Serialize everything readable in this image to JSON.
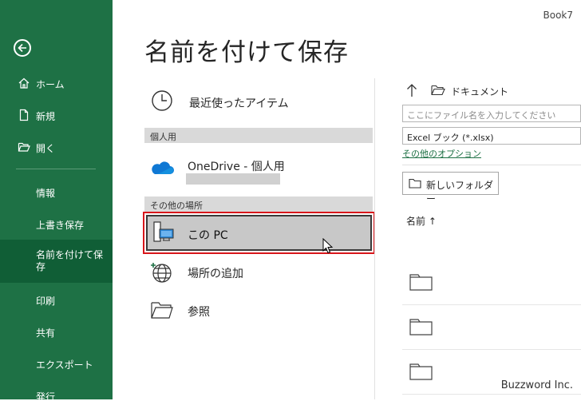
{
  "window": {
    "doc_name": "Book7"
  },
  "sidebar": {
    "items": [
      {
        "label": "ホーム"
      },
      {
        "label": "新規"
      },
      {
        "label": "開く"
      },
      {
        "label": "情報"
      },
      {
        "label": "上書き保存"
      },
      {
        "label": "名前を付けて保存"
      },
      {
        "label": "印刷"
      },
      {
        "label": "共有"
      },
      {
        "label": "エクスポート"
      },
      {
        "label": "発行"
      }
    ],
    "accent": "#1e7145",
    "selected_bg": "#105e36"
  },
  "main": {
    "title": "名前を付けて保存",
    "recent": "最近使ったアイテム",
    "section_personal": "個人用",
    "onedrive": "OneDrive - 個人用",
    "section_other": "その他の場所",
    "this_pc": "この PC",
    "add_place": "場所の追加",
    "browse": "参照"
  },
  "right": {
    "path": "ドキュメント",
    "filename_placeholder": "ここにファイル名を入力してください",
    "filetype": "Excel ブック (*.xlsx)",
    "more_options": "その他のオプション",
    "new_folder": "新しいフォルダー",
    "name_header": "名前 ↑"
  },
  "watermark": "Buzzword Inc.",
  "colors": {
    "highlight_border": "#d8161b",
    "onedrive_blue": "#0f78d4"
  }
}
